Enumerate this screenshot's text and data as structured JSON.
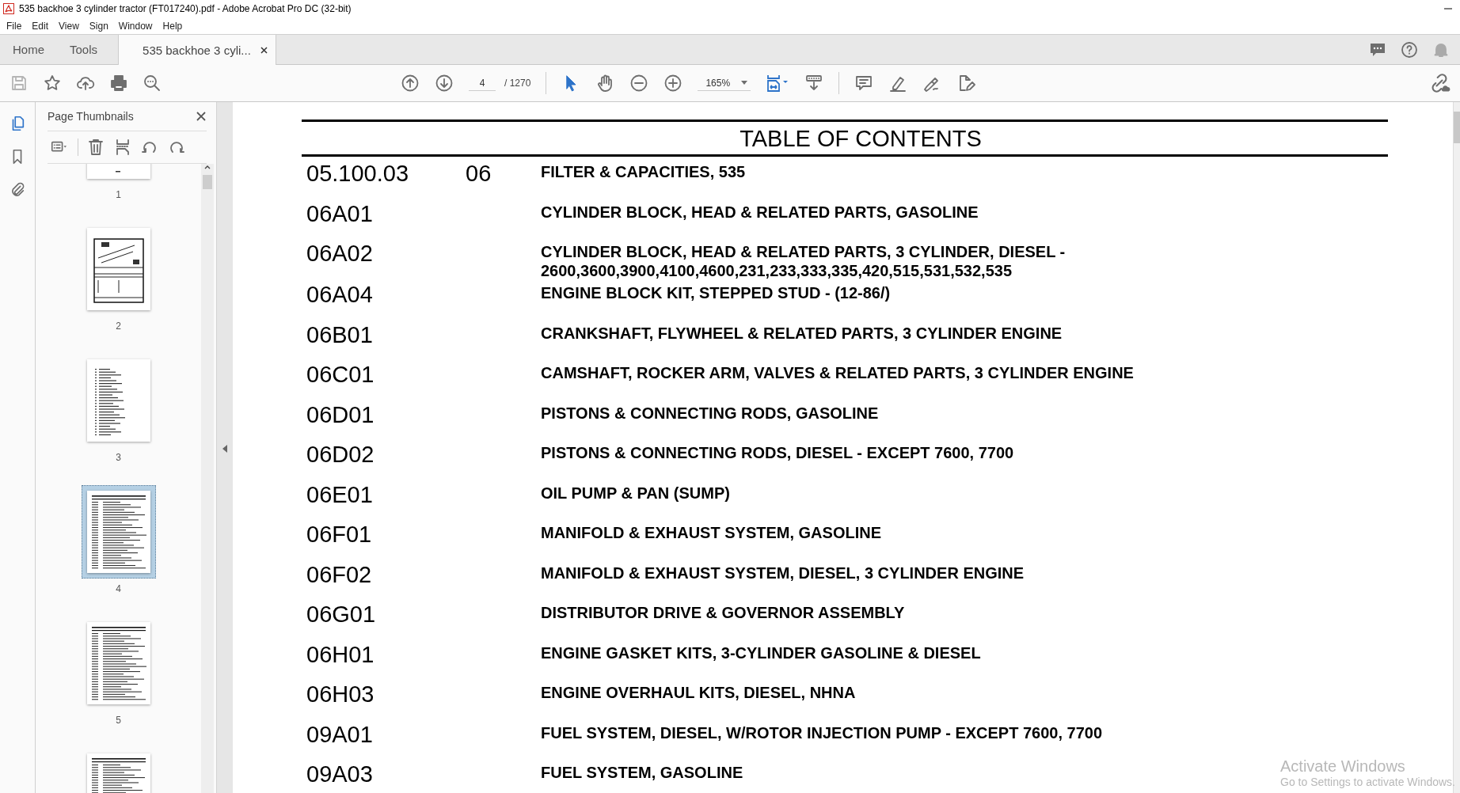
{
  "window": {
    "title": "535 backhoe 3 cylinder tractor (FT017240).pdf - Adobe Acrobat Pro DC (32-bit)"
  },
  "menu": [
    "File",
    "Edit",
    "View",
    "Sign",
    "Window",
    "Help"
  ],
  "tabs": [
    {
      "label": "Home",
      "selected": false
    },
    {
      "label": "Tools",
      "selected": false
    },
    {
      "label": "535 backhoe 3 cyli...",
      "selected": true
    }
  ],
  "toolbar": {
    "page_number": "4",
    "page_count": "/ 1270",
    "zoom": "165%"
  },
  "rail": [
    {
      "kind": "pages",
      "selected": true
    },
    {
      "kind": "bookmarks",
      "selected": false
    },
    {
      "kind": "attachments",
      "selected": false
    }
  ],
  "sidebar": {
    "title": "Page Thumbnails",
    "thumbnails": [
      {
        "label": "1",
        "kind": "blank",
        "selected": false
      },
      {
        "label": "2",
        "kind": "diagram",
        "selected": false
      },
      {
        "label": "3",
        "kind": "list",
        "selected": false
      },
      {
        "label": "4",
        "kind": "table",
        "selected": true
      },
      {
        "label": "5",
        "kind": "table",
        "selected": false
      },
      {
        "kind": "table",
        "selected": false
      }
    ]
  },
  "document": {
    "title": "TABLE OF CONTENTS",
    "rows": [
      {
        "code": "05.100.03",
        "section": "06",
        "description": [
          "FILTER & CAPACITIES, 535"
        ]
      },
      {
        "code": "06A01",
        "description": [
          "CYLINDER BLOCK, HEAD & RELATED PARTS, GASOLINE"
        ]
      },
      {
        "code": "06A02",
        "description": [
          "CYLINDER BLOCK, HEAD & RELATED PARTS, 3 CYLINDER, DIESEL -",
          "2600,3600,3900,4100,4600,231,233,333,335,420,515,531,532,535"
        ]
      },
      {
        "code": "06A04",
        "description": [
          "ENGINE BLOCK KIT, STEPPED STUD - (12-86/)"
        ]
      },
      {
        "code": "06B01",
        "description": [
          "CRANKSHAFT, FLYWHEEL & RELATED PARTS, 3 CYLINDER ENGINE"
        ]
      },
      {
        "code": "06C01",
        "description": [
          "CAMSHAFT, ROCKER ARM, VALVES & RELATED PARTS, 3 CYLINDER ENGINE"
        ]
      },
      {
        "code": "06D01",
        "description": [
          "PISTONS & CONNECTING RODS, GASOLINE"
        ]
      },
      {
        "code": "06D02",
        "description": [
          "PISTONS & CONNECTING RODS, DIESEL - EXCEPT 7600, 7700"
        ]
      },
      {
        "code": "06E01",
        "description": [
          "OIL PUMP & PAN (SUMP)"
        ]
      },
      {
        "code": "06F01",
        "description": [
          "MANIFOLD & EXHAUST SYSTEM, GASOLINE"
        ]
      },
      {
        "code": "06F02",
        "description": [
          "MANIFOLD & EXHAUST SYSTEM, DIESEL, 3 CYLINDER ENGINE"
        ]
      },
      {
        "code": "06G01",
        "description": [
          "DISTRIBUTOR DRIVE & GOVERNOR ASSEMBLY"
        ]
      },
      {
        "code": "06H01",
        "description": [
          "ENGINE GASKET KITS, 3-CYLINDER GASOLINE & DIESEL"
        ]
      },
      {
        "code": "06H03",
        "description": [
          "ENGINE OVERHAUL KITS, DIESEL, NHNA"
        ]
      },
      {
        "code": "09A01",
        "description": [
          "FUEL SYSTEM, DIESEL, W/ROTOR INJECTION PUMP - EXCEPT 7600, 7700"
        ]
      },
      {
        "code": "09A03",
        "description": [
          "FUEL SYSTEM, GASOLINE"
        ]
      }
    ]
  },
  "watermark": {
    "title": "Activate Windows",
    "subtitle": "Go to Settings to activate Windows."
  }
}
